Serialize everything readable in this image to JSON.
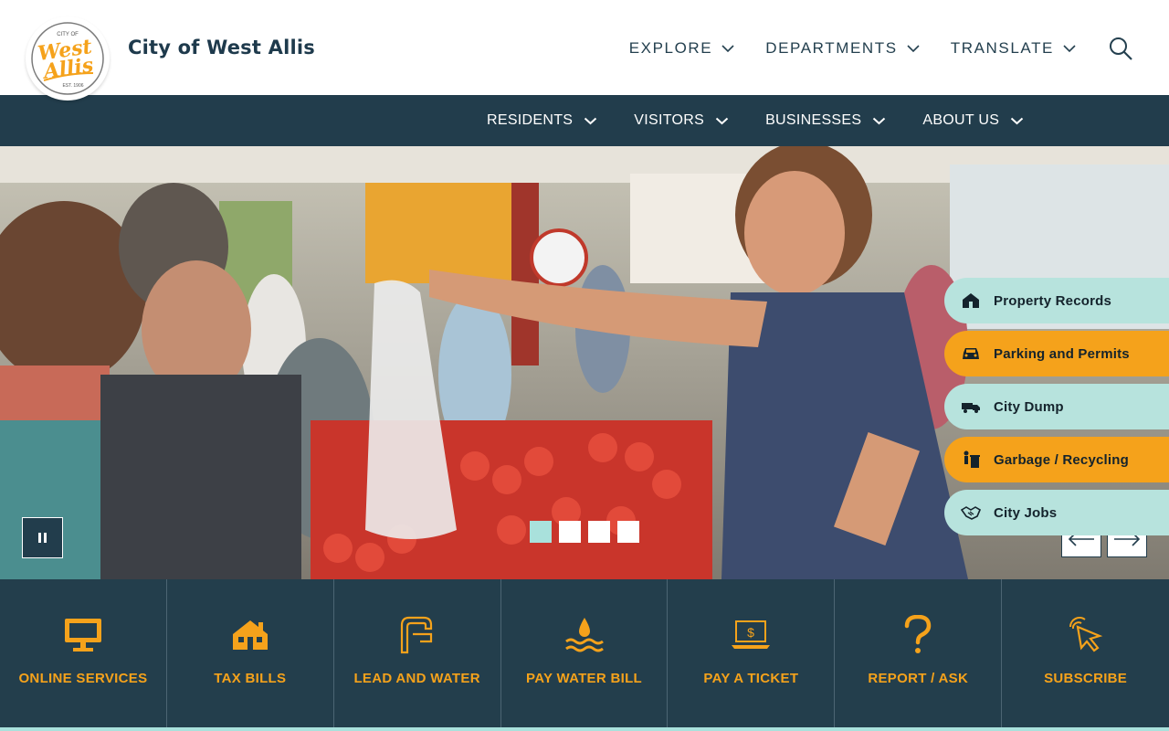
{
  "header": {
    "site_title": "City of West Allis",
    "logo": {
      "top_text": "CITY OF",
      "line1": "West",
      "line2": "Allis",
      "est": "EST. 1906"
    },
    "util_nav": [
      {
        "label": "EXPLORE"
      },
      {
        "label": "DEPARTMENTS"
      },
      {
        "label": "TRANSLATE"
      }
    ],
    "search_icon": "search-icon"
  },
  "main_nav": [
    {
      "label": "RESIDENTS"
    },
    {
      "label": "VISITORS"
    },
    {
      "label": "BUSINESSES"
    },
    {
      "label": "ABOUT US"
    }
  ],
  "hero": {
    "image_subject": "farmers market vendor handing produce bag to customer",
    "slides_count": 4,
    "active_slide": 1,
    "pause_icon": "pause-icon",
    "prev_icon": "arrow-left-icon",
    "next_icon": "arrow-right-icon"
  },
  "quick_links": [
    {
      "label": "Property Records",
      "icon": "house-icon",
      "style": "mint"
    },
    {
      "label": "Parking and Permits",
      "icon": "car-icon",
      "style": "gold"
    },
    {
      "label": "City Dump",
      "icon": "truck-icon",
      "style": "mint"
    },
    {
      "label": "Garbage / Recycling",
      "icon": "recycling-icon",
      "style": "gold"
    },
    {
      "label": "City Jobs",
      "icon": "handshake-icon",
      "style": "mint"
    }
  ],
  "services": [
    {
      "label": "ONLINE SERVICES",
      "icon": "monitor-icon"
    },
    {
      "label": "TAX BILLS",
      "icon": "house-icon"
    },
    {
      "label": "LEAD AND WATER",
      "icon": "faucet-icon"
    },
    {
      "label": "PAY WATER BILL",
      "icon": "water-drop-icon"
    },
    {
      "label": "PAY A TICKET",
      "icon": "laptop-dollar-icon"
    },
    {
      "label": "REPORT / ASK",
      "icon": "question-icon"
    },
    {
      "label": "SUBSCRIBE",
      "icon": "cursor-click-icon"
    }
  ],
  "colors": {
    "navy": "#223d4c",
    "gold": "#f5a21b",
    "mint": "#b7e3dd",
    "title": "#1e3a4c"
  }
}
